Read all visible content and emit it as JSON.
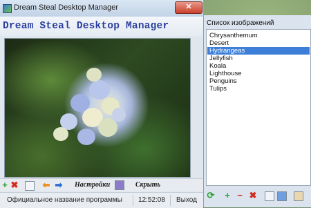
{
  "window": {
    "title": "Dream Steal Desktop Manager",
    "close_label": "✕"
  },
  "header": {
    "heading": "Dream Steal Desktop Manager"
  },
  "toolbar": {
    "add_icon": "+",
    "remove_icon": "✖",
    "settings_label": "Настройки",
    "hide_label": "Скрыть"
  },
  "status": {
    "program_name": "Официальное название программы",
    "time": "12:52:08",
    "exit_label": "Выход"
  },
  "image_list": {
    "header": "Список изображений",
    "items": [
      {
        "label": "Chrysanthemum",
        "selected": false
      },
      {
        "label": "Desert",
        "selected": false
      },
      {
        "label": "Hydrangeas",
        "selected": true
      },
      {
        "label": "Jellyfish",
        "selected": false
      },
      {
        "label": "Koala",
        "selected": false
      },
      {
        "label": "Lighthouse",
        "selected": false
      },
      {
        "label": "Penguins",
        "selected": false
      },
      {
        "label": "Tulips",
        "selected": false
      }
    ],
    "add_icon": "+",
    "minus_icon": "−",
    "delete_icon": "✖"
  },
  "colors": {
    "heading": "#2c3f9e",
    "selection": "#3d7fd8",
    "add_green": "#2f9e2f",
    "delete_red": "#d22a1e",
    "arrow_orange": "#e8901e",
    "arrow_blue": "#2d6fd0"
  }
}
